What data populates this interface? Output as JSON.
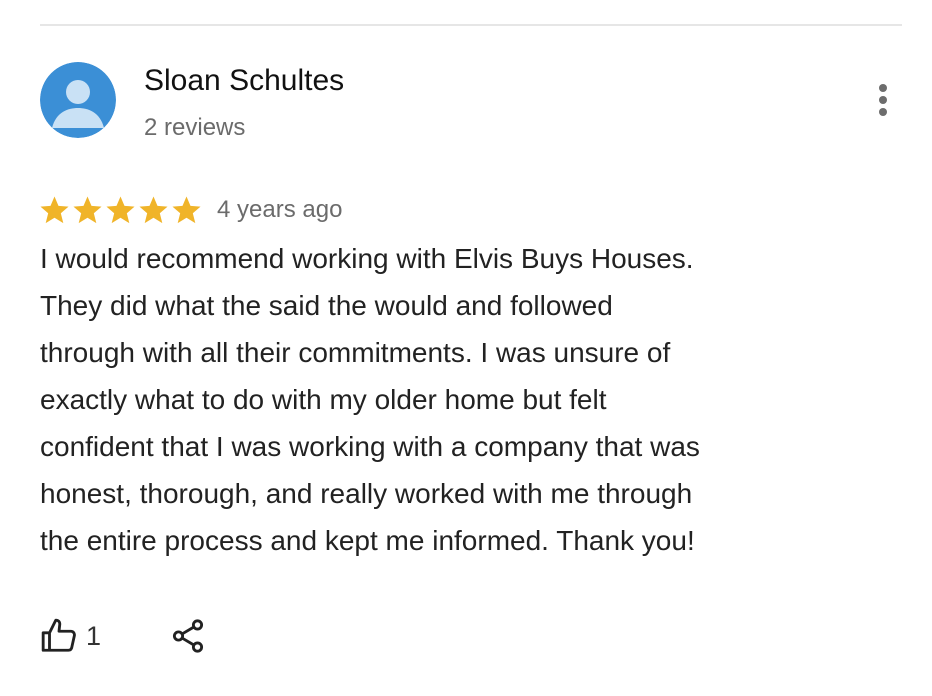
{
  "reviewer": {
    "name": "Sloan Schultes",
    "reviews_count": "2 reviews",
    "avatar_color": "#3b8fd6"
  },
  "review": {
    "rating": 5,
    "rating_max": 5,
    "time": "4 years ago",
    "text": "I would recommend working with Elvis Buys Houses.\nThey did what the said the would and followed\nthrough with all their commitments.  I was unsure of\nexactly what to do with my older home but felt\nconfident that I was working with a company that was\nhonest, thorough, and really worked with me through\nthe entire process and kept me informed.  Thank you!",
    "star_color": "#f0b429"
  },
  "actions": {
    "like_count": "1",
    "like_icon": "thumbs-up-icon",
    "share_icon": "share-icon",
    "more_icon": "more-vert-icon"
  }
}
